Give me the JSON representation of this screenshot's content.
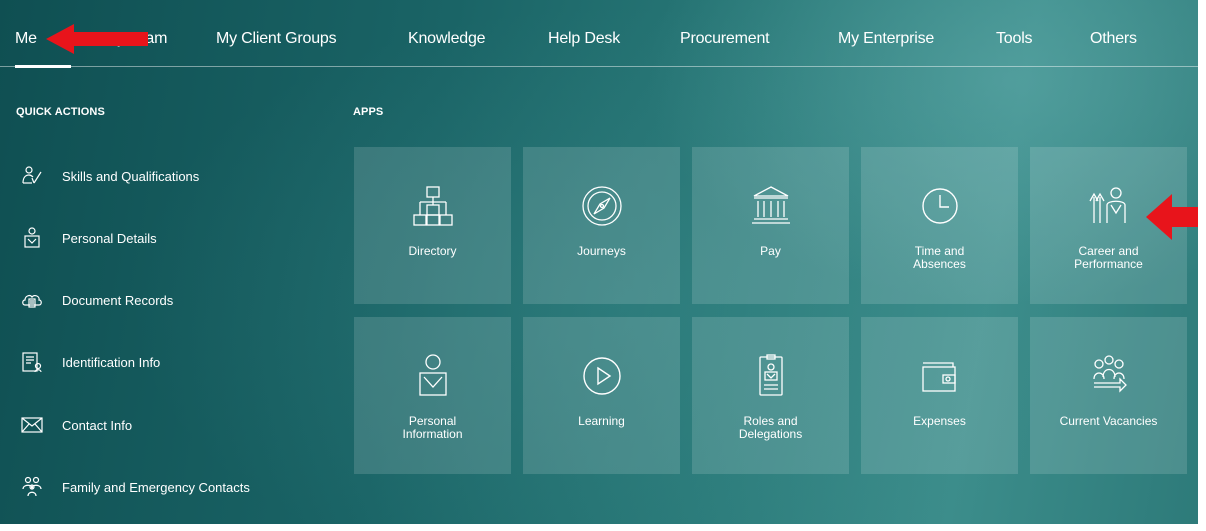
{
  "nav": {
    "items": [
      {
        "label": "Me"
      },
      {
        "label": "My Team"
      },
      {
        "label": "My Client Groups"
      },
      {
        "label": "Knowledge"
      },
      {
        "label": "Help Desk"
      },
      {
        "label": "Procurement"
      },
      {
        "label": "My Enterprise"
      },
      {
        "label": "Tools"
      },
      {
        "label": "Others"
      }
    ]
  },
  "quick_actions": {
    "title": "QUICK ACTIONS",
    "items": [
      {
        "label": "Skills and Qualifications",
        "icon": "skills-icon"
      },
      {
        "label": "Personal Details",
        "icon": "person-card-icon"
      },
      {
        "label": "Document Records",
        "icon": "document-cloud-icon"
      },
      {
        "label": "Identification Info",
        "icon": "id-card-icon"
      },
      {
        "label": "Contact Info",
        "icon": "envelope-icon"
      },
      {
        "label": "Family and Emergency Contacts",
        "icon": "family-icon"
      }
    ]
  },
  "apps": {
    "title": "APPS",
    "tiles": [
      {
        "label": "Directory",
        "icon": "org-chart-icon"
      },
      {
        "label": "Journeys",
        "icon": "compass-icon"
      },
      {
        "label": "Pay",
        "icon": "bank-icon"
      },
      {
        "label": "Time and\nAbsences",
        "icon": "clock-icon"
      },
      {
        "label": "Career and\nPerformance",
        "icon": "career-icon"
      },
      {
        "label": "Personal\nInformation",
        "icon": "person-icon"
      },
      {
        "label": "Learning",
        "icon": "play-icon"
      },
      {
        "label": "Roles and\nDelegations",
        "icon": "badge-icon"
      },
      {
        "label": "Expenses",
        "icon": "wallet-icon"
      },
      {
        "label": "Current Vacancies",
        "icon": "vacancies-icon"
      }
    ]
  },
  "annotations": {
    "arrow_color": "#e8141b",
    "arrows": [
      {
        "name": "arrow-pointing-to-me-tab"
      },
      {
        "name": "arrow-pointing-to-career-tile"
      }
    ]
  },
  "colors": {
    "background": "#1f6b6c",
    "tile": "rgba(255,255,255,0.14)",
    "text": "#ffffff"
  }
}
